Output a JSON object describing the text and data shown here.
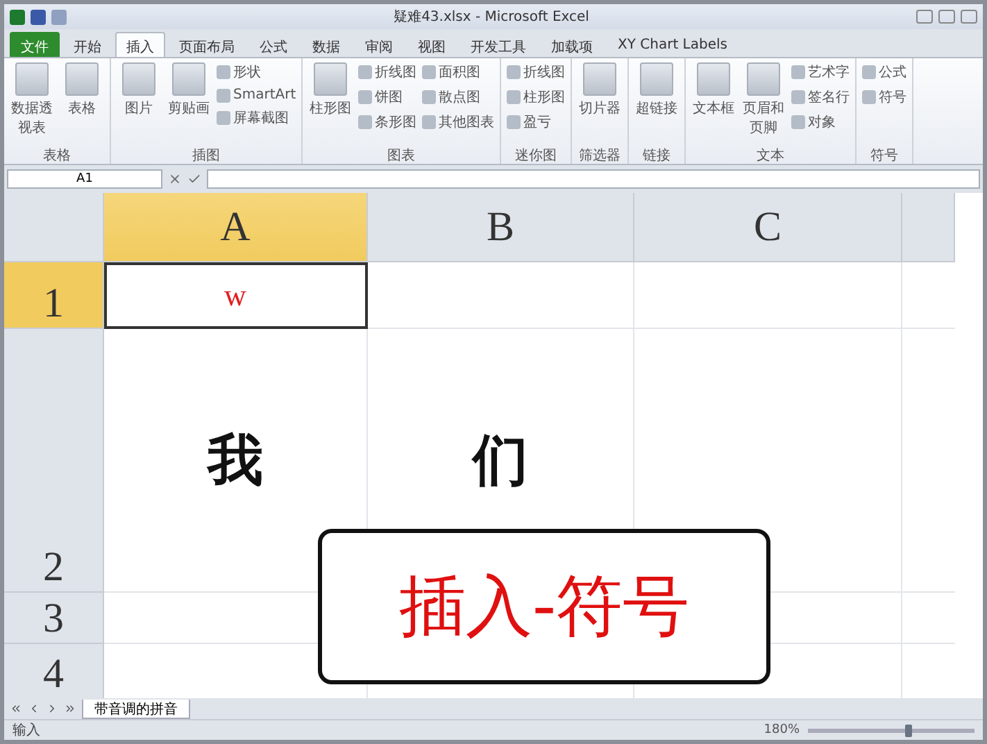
{
  "window": {
    "title": "疑难43.xlsx - Microsoft Excel"
  },
  "tabs": [
    {
      "label": "文件",
      "kind": "file",
      "selected": false
    },
    {
      "label": "开始",
      "kind": "tab",
      "selected": false
    },
    {
      "label": "插入",
      "kind": "tab",
      "selected": true
    },
    {
      "label": "页面布局",
      "kind": "tab",
      "selected": false
    },
    {
      "label": "公式",
      "kind": "tab",
      "selected": false
    },
    {
      "label": "数据",
      "kind": "tab",
      "selected": false
    },
    {
      "label": "审阅",
      "kind": "tab",
      "selected": false
    },
    {
      "label": "视图",
      "kind": "tab",
      "selected": false
    },
    {
      "label": "开发工具",
      "kind": "tab",
      "selected": false
    },
    {
      "label": "加载项",
      "kind": "tab",
      "selected": false
    },
    {
      "label": "XY Chart Labels",
      "kind": "tab",
      "selected": false
    }
  ],
  "ribbon": [
    {
      "label": "表格",
      "items": [
        {
          "label": "数据透视表",
          "kind": "large"
        },
        {
          "label": "表格",
          "kind": "large"
        }
      ]
    },
    {
      "label": "插图",
      "items": [
        {
          "label": "图片",
          "kind": "large"
        },
        {
          "label": "剪贴画",
          "kind": "large"
        },
        {
          "label": "形状",
          "kind": "small"
        },
        {
          "label": "SmartArt",
          "kind": "small"
        },
        {
          "label": "屏幕截图",
          "kind": "small"
        }
      ]
    },
    {
      "label": "图表",
      "items": [
        {
          "label": "柱形图",
          "kind": "large"
        },
        {
          "label": "折线图",
          "kind": "small"
        },
        {
          "label": "饼图",
          "kind": "small"
        },
        {
          "label": "条形图",
          "kind": "small"
        },
        {
          "label": "面积图",
          "kind": "small"
        },
        {
          "label": "散点图",
          "kind": "small"
        },
        {
          "label": "其他图表",
          "kind": "small"
        }
      ]
    },
    {
      "label": "迷你图",
      "items": [
        {
          "label": "折线图",
          "kind": "small"
        },
        {
          "label": "柱形图",
          "kind": "small"
        },
        {
          "label": "盈亏",
          "kind": "small"
        }
      ]
    },
    {
      "label": "筛选器",
      "items": [
        {
          "label": "切片器",
          "kind": "large"
        }
      ]
    },
    {
      "label": "链接",
      "items": [
        {
          "label": "超链接",
          "kind": "large"
        }
      ]
    },
    {
      "label": "文本",
      "items": [
        {
          "label": "文本框",
          "kind": "large"
        },
        {
          "label": "页眉和页脚",
          "kind": "large"
        },
        {
          "label": "艺术字",
          "kind": "small"
        },
        {
          "label": "签名行",
          "kind": "small"
        },
        {
          "label": "对象",
          "kind": "small"
        }
      ]
    },
    {
      "label": "符号",
      "items": [
        {
          "label": "公式",
          "kind": "small"
        },
        {
          "label": "符号",
          "kind": "small"
        }
      ]
    }
  ],
  "name_box": "A1",
  "columns": [
    {
      "label": "A",
      "selected": true
    },
    {
      "label": "B",
      "selected": false
    },
    {
      "label": "C",
      "selected": false
    }
  ],
  "rows": [
    {
      "label": "1",
      "selected": true,
      "cells": [
        {
          "text": "w",
          "selected": true
        },
        {
          "selected": false
        },
        {
          "selected": false
        }
      ]
    },
    {
      "label": "2",
      "selected": false,
      "cells": [
        {
          "text": "我",
          "selected": false
        },
        {
          "text": "们",
          "selected": false
        },
        {
          "selected": false
        }
      ]
    },
    {
      "label": "3",
      "selected": false,
      "cells": [
        {
          "selected": false
        },
        {},
        {
          "selected": false
        }
      ]
    },
    {
      "label": "4",
      "selected": false,
      "cells": [
        {
          "selected": false
        },
        {
          "selected": false
        },
        {
          "selected": false
        }
      ]
    }
  ],
  "callout": {
    "text": "插入-符号"
  },
  "sheet_tabs": [
    {
      "label": "带音调的拼音",
      "selected": true
    }
  ],
  "status_bar": {
    "mode": "输入",
    "zoom": "180%",
    "zoom_slider": {
      "level": 0.6
    }
  }
}
